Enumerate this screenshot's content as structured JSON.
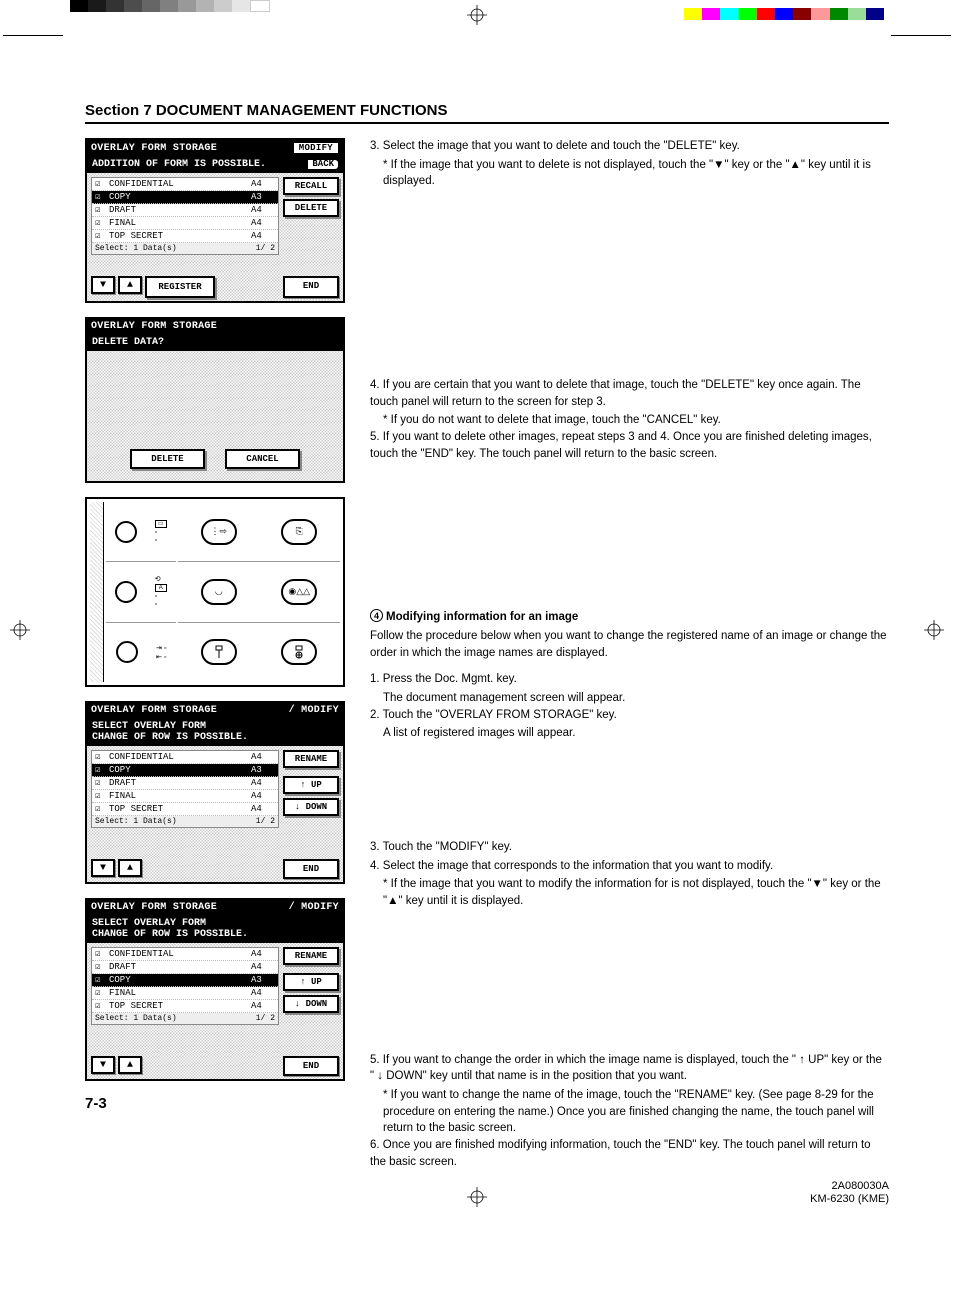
{
  "section_title": "Section 7  DOCUMENT MANAGEMENT FUNCTIONS",
  "page_number": "7-3",
  "footer": {
    "code": "2A080030A",
    "model": "KM-6230 (KME)"
  },
  "panel1": {
    "title": "OVERLAY FORM STORAGE",
    "modify": "MODIFY",
    "subtitle": "ADDITION OF FORM IS POSSIBLE.",
    "back": "BACK",
    "files": [
      {
        "name": "CONFIDENTIAL",
        "size": "A4",
        "sel": false
      },
      {
        "name": "COPY",
        "size": "A3",
        "sel": true
      },
      {
        "name": "DRAFT",
        "size": "A4",
        "sel": false
      },
      {
        "name": "FINAL",
        "size": "A4",
        "sel": false
      },
      {
        "name": "TOP SECRET",
        "size": "A4",
        "sel": false
      }
    ],
    "select_text": "Select:  1 Data(s)",
    "page_ind": "1/ 2",
    "buttons": {
      "recall": "RECALL",
      "delete": "DELETE",
      "register": "REGISTER",
      "end": "END"
    }
  },
  "panel2": {
    "title": "OVERLAY FORM STORAGE",
    "prompt": "DELETE DATA?",
    "delete": "DELETE",
    "cancel": "CANCEL"
  },
  "panel3": {
    "title": "OVERLAY FORM STORAGE",
    "modify": "/ MODIFY",
    "subtitle": "SELECT OVERLAY FORM\nCHANGE OF ROW IS POSSIBLE.",
    "files": [
      {
        "name": "CONFIDENTIAL",
        "size": "A4",
        "sel": false
      },
      {
        "name": "COPY",
        "size": "A3",
        "sel": true
      },
      {
        "name": "DRAFT",
        "size": "A4",
        "sel": false
      },
      {
        "name": "FINAL",
        "size": "A4",
        "sel": false
      },
      {
        "name": "TOP SECRET",
        "size": "A4",
        "sel": false
      }
    ],
    "select_text": "Select:  1 Data(s)",
    "page_ind": "1/ 2",
    "buttons": {
      "rename": "RENAME",
      "up": "↑  UP",
      "down": "↓ DOWN",
      "end": "END"
    }
  },
  "panel4": {
    "title": "OVERLAY FORM STORAGE",
    "modify": "/ MODIFY",
    "subtitle": "SELECT OVERLAY FORM\nCHANGE OF ROW IS POSSIBLE.",
    "files": [
      {
        "name": "CONFIDENTIAL",
        "size": "A4",
        "sel": false
      },
      {
        "name": "DRAFT",
        "size": "A4",
        "sel": false
      },
      {
        "name": "COPY",
        "size": "A3",
        "sel": true
      },
      {
        "name": "FINAL",
        "size": "A4",
        "sel": false
      },
      {
        "name": "TOP SECRET",
        "size": "A4",
        "sel": false
      }
    ],
    "select_text": "Select:  1 Data(s)",
    "page_ind": "1/ 2",
    "buttons": {
      "rename": "RENAME",
      "up": "↑  UP",
      "down": "↓ DOWN",
      "end": "END"
    }
  },
  "text": {
    "block1": {
      "step3": "3. Select the image that you want to delete and touch the \"DELETE\" key.",
      "note3": "* If the image that you want to delete is not displayed, touch the \"▼\" key or the \"▲\" key until it is displayed."
    },
    "block2": {
      "step4a": "4. If you are certain that you want to delete that image, touch the \"DELETE\" key once again. The touch panel will return to the screen for step 3.",
      "note4": "* If you do not want to delete that image, touch the \"CANCEL\" key.",
      "step5": "5. If you want to delete other images, repeat steps 3 and 4. Once you are finished deleting images, touch the \"END\" key. The touch panel will return to the basic screen."
    },
    "block3": {
      "head_num": "4",
      "head": "Modifying information for an image",
      "intro": "Follow the procedure below when you want to change the registered name of an image or change the order in which the image names are displayed.",
      "step1": "1. Press the Doc. Mgmt. key.",
      "step1b": "The document management screen will appear.",
      "step2": "2. Touch the \"OVERLAY FROM STORAGE\" key.",
      "step2b": "A list of registered images will appear."
    },
    "block4": {
      "step3": "3. Touch the \"MODIFY\" key.",
      "step4": "4. Select the image that corresponds to the information that you want to modify.",
      "note4": "* If the image that you want to modify the information for is not displayed, touch the \"▼\" key or the \"▲\" key until it is displayed."
    },
    "block5": {
      "step5": "5. If you want to change the order in which the image name is displayed, touch the \" ↑  UP\" key or the \" ↓ DOWN\" key until that name is in the position that you want.",
      "note5": "* If you want to change the name of the image, touch the \"RENAME\" key. (See page 8-29 for the procedure on entering the name.) Once you are finished changing the name, the touch panel will return to the basic screen.",
      "step6": "6. Once you are finished modifying information, touch the \"END\" key. The touch panel will return to the basic screen."
    }
  }
}
